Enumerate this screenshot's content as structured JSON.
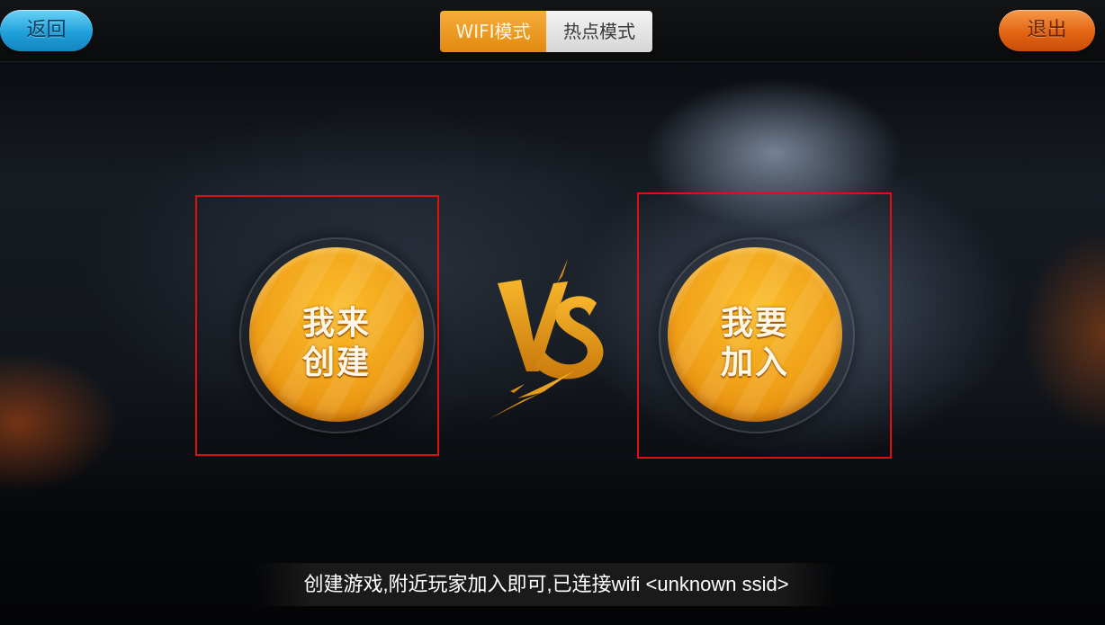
{
  "topbar": {
    "back_label": "返回",
    "exit_label": "退出",
    "tabs": [
      {
        "label": "WIFI模式",
        "active": true
      },
      {
        "label": "热点模式",
        "active": false
      }
    ]
  },
  "main": {
    "create": {
      "line1": "我来",
      "line2": "创建"
    },
    "join": {
      "line1": "我要",
      "line2": "加入"
    },
    "vs_icon": "vs-emblem-icon"
  },
  "status": {
    "message": "创建游戏,附近玩家加入即可,已连接wifi <unknown ssid>"
  },
  "colors": {
    "accent_orange": "#f0a118",
    "back_blue": "#1fa0da",
    "exit_orange": "#e36413",
    "highlight_red": "#e01010"
  }
}
